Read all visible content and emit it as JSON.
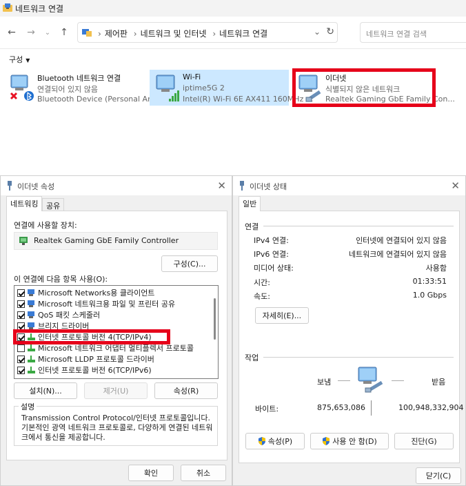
{
  "network_window": {
    "title": "네트워크 연결",
    "breadcrumbs": [
      "제어판",
      "네트워크 및 인터넷",
      "네트워크 연결"
    ],
    "search_placeholder": "네트워크 연결 검색",
    "organize_label": "구성",
    "adapters": [
      {
        "name": "Bluetooth 네트워크 연결",
        "status": "연결되어 있지 않음",
        "device": "Bluetooth Device (Personal Area ..."
      },
      {
        "name": "Wi-Fi",
        "status": "iptime5G 2",
        "device": "Intel(R) Wi-Fi 6E AX411 160MHz ..."
      },
      {
        "name": "이더넷",
        "status": "식별되지 않은 네트워크",
        "device": "Realtek Gaming GbE Family Con..."
      }
    ]
  },
  "properties_dialog": {
    "title": "이더넷 속성",
    "tabs": [
      "네트워킹",
      "공유"
    ],
    "connect_using_label": "연결에 사용할 장치:",
    "device_name": "Realtek Gaming GbE Family Controller",
    "configure_label": "구성(C)...",
    "items_label": "이 연결에 다음 항목 사용(O):",
    "items": [
      {
        "label": "Microsoft Networks용 클라이언트",
        "checked": true
      },
      {
        "label": "Microsoft 네트워크용 파일 및 프린터 공유",
        "checked": true
      },
      {
        "label": "QoS 패킷 스케줄러",
        "checked": true
      },
      {
        "label": "브리지 드라이버",
        "checked": true
      },
      {
        "label": "인터넷 프로토콜 버전 4(TCP/IPv4)",
        "checked": true
      },
      {
        "label": "Microsoft 네트워크 어댑터 멀티플렉서 프로토콜",
        "checked": false
      },
      {
        "label": "Microsoft LLDP 프로토콜 드라이버",
        "checked": true
      },
      {
        "label": "인터넷 프로토콜 버전 6(TCP/IPv6)",
        "checked": true
      }
    ],
    "install_label": "설치(N)...",
    "uninstall_label": "제거(U)",
    "properties_label": "속성(R)",
    "description_title": "설명",
    "description_text": "Transmission Control Protocol/인터넷 프로토콜입니다. 기본적인 광역 네트워크 프로토콜로, 다양하게 연결된 네트워크에서 통신을 제공합니다.",
    "ok_label": "확인",
    "cancel_label": "취소"
  },
  "status_dialog": {
    "title": "이더넷 상태",
    "tab": "일반",
    "connection_title": "연결",
    "rows": [
      {
        "key": "IPv4 연결:",
        "value": "인터넷에 연결되어 있지 않음"
      },
      {
        "key": "IPv6 연결:",
        "value": "네트워크에 연결되어 있지 않음"
      },
      {
        "key": "미디어 상태:",
        "value": "사용함"
      },
      {
        "key": "시간:",
        "value": "01:33:51"
      },
      {
        "key": "속도:",
        "value": "1.0 Gbps"
      }
    ],
    "details_label": "자세히(E)...",
    "activity_title": "작업",
    "sent_label": "보냄",
    "received_label": "받음",
    "bytes_label": "바이트:",
    "bytes_sent": "875,653,086",
    "bytes_received": "100,948,332,904",
    "properties_label": "속성(P)",
    "disable_label": "사용 안 함(D)",
    "diagnose_label": "진단(G)",
    "close_label": "닫기(C)"
  },
  "colors": {
    "highlight_red": "#e6001a",
    "selection_blue": "#cce8ff"
  },
  "icons": [
    "network-folder-icon",
    "back-arrow-icon",
    "forward-arrow-icon",
    "up-arrow-icon",
    "refresh-icon",
    "bluetooth-icon",
    "wifi-signal-icon",
    "ethernet-icon",
    "close-icon",
    "uac-shield-icon"
  ]
}
